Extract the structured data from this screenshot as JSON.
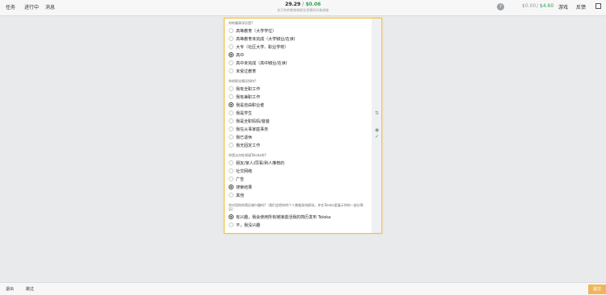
{
  "topbar": {
    "nav_left": [
      "任务",
      "进行中",
      "消息"
    ],
    "counter_main": "29.29",
    "counter_sep": "/",
    "counter_earn": "$0.06",
    "subline": "关于你的教育和职业背景的问卷调查",
    "balance_gray": "$0.00",
    "balance_sep": "/",
    "balance_green": "$4.60",
    "nav_right": [
      "游戏",
      "反馈"
    ]
  },
  "survey": {
    "questions": [
      {
        "label": "你的最高学历是?",
        "options": [
          {
            "label": "高等教育（大学学位）",
            "checked": false
          },
          {
            "label": "高等教育未完成（大学肄业/在读）",
            "checked": false
          },
          {
            "label": "大专（社区大学、职业学校）",
            "checked": false
          },
          {
            "label": "高中",
            "checked": true
          },
          {
            "label": "高中未完成（高中肄业/在读）",
            "checked": false
          },
          {
            "label": "未受过教育",
            "checked": false
          }
        ]
      },
      {
        "label": "你的职业情况如何?",
        "options": [
          {
            "label": "我有全职工作",
            "checked": false
          },
          {
            "label": "我有兼职工作",
            "checked": false
          },
          {
            "label": "我是自由职业者",
            "checked": true
          },
          {
            "label": "我是学生",
            "checked": false
          },
          {
            "label": "我是全职妈妈/爸爸",
            "checked": false
          },
          {
            "label": "我在从事家庭事务",
            "checked": false
          },
          {
            "label": "我已退休",
            "checked": false
          },
          {
            "label": "我无固定工作",
            "checked": false
          }
        ]
      },
      {
        "label": "你是从何处知道Toloka的?",
        "options": [
          {
            "label": "朋友/家人/同事/熟人推荐的",
            "checked": false
          },
          {
            "label": "社交网络",
            "checked": false
          },
          {
            "label": "广告",
            "checked": false
          },
          {
            "label": "搜索结果",
            "checked": true
          },
          {
            "label": "其他",
            "checked": false
          }
        ]
      },
      {
        "label": "你对用你的简历感兴趣吗?（我们会把你的个人数据发给职场，并在Toloka里展示你的一部分简历）",
        "options": [
          {
            "label": "有兴趣，我会使用所有链接激活我的简历发布 Toloka",
            "checked": true
          },
          {
            "label": "不，我没兴趣",
            "checked": false
          }
        ]
      }
    ]
  },
  "sidebar": {
    "icons": [
      "sort-icon",
      "eye-icon",
      "check-icon"
    ]
  },
  "bottombar": {
    "exit_label": "退出",
    "skip_label": "跳过",
    "submit_label": "提交"
  },
  "colors": {
    "accent_green": "#2aa34a",
    "card_border": "#f0c14b",
    "badge": "#f0b55a"
  }
}
